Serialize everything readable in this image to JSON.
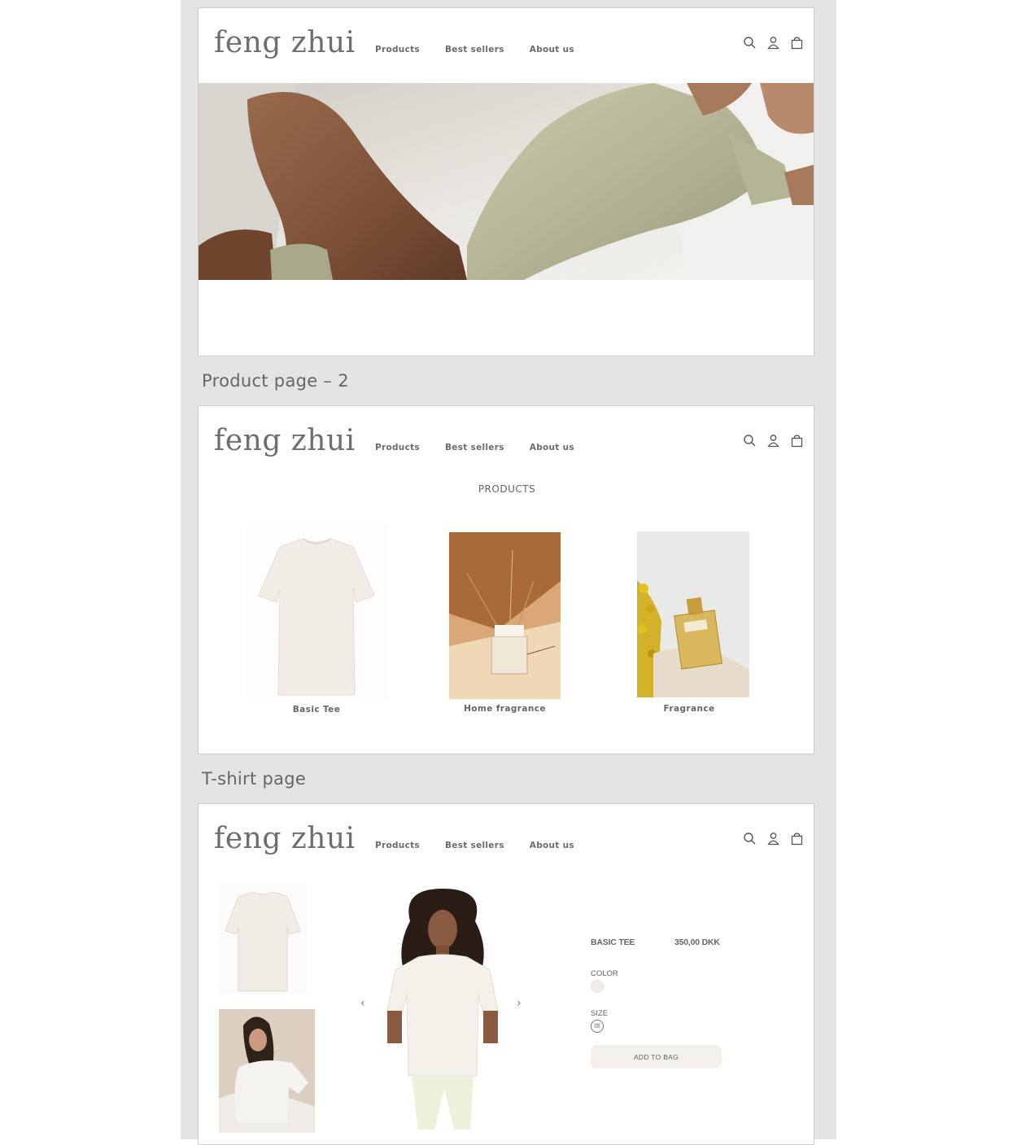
{
  "brand": {
    "logo": "feng zhui"
  },
  "nav": {
    "products": "Products",
    "best_sellers": "Best sellers",
    "about_us": "About us"
  },
  "icons": [
    "search-icon",
    "user-icon",
    "bag-icon"
  ],
  "frame_labels": {
    "product_page": "Product page – 2",
    "tshirt_page": "T-shirt page"
  },
  "products_page": {
    "title": "PRODUCTS",
    "items": [
      {
        "label": "Basic Tee"
      },
      {
        "label": "Home fragrance"
      },
      {
        "label": "Fragrance"
      }
    ]
  },
  "tshirt_page": {
    "product_name": "BASIC TEE",
    "price": "350,00 DKK",
    "color_label": "COLOR",
    "size_label": "SIZE",
    "size_value": "ONE SIZE",
    "add_to_bag": "ADD TO BAG",
    "prev_arrow": "‹",
    "next_arrow": "›"
  },
  "colors": {
    "canvas": "#e4e4e4",
    "text": "#666666",
    "button_bg": "#f3efeb",
    "tee": "#f1ede6",
    "bodysuit": "#b9b99a"
  }
}
